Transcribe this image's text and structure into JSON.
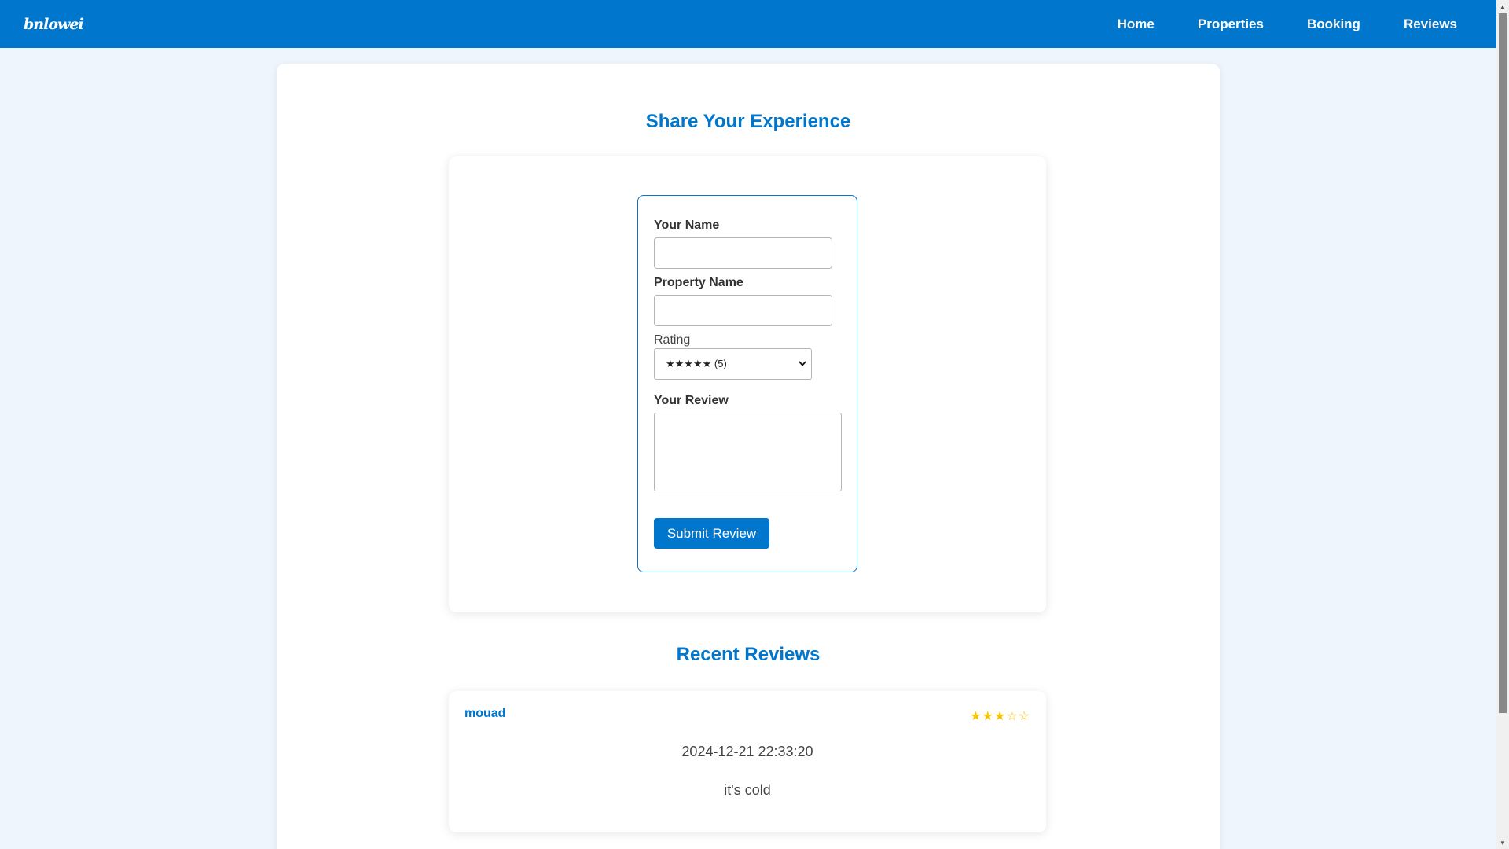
{
  "nav": {
    "logo": "bnlowei",
    "links": [
      "Home",
      "Properties",
      "Booking",
      "Reviews"
    ]
  },
  "form_section": {
    "title": "Share Your Experience",
    "name_label": "Your Name",
    "name_value": "",
    "property_label": "Property Name",
    "property_value": "",
    "rating_label": "Rating",
    "rating_selected": "★★★★★ (5)",
    "review_label": "Your Review",
    "review_value": "",
    "submit_label": "Submit Review"
  },
  "recent_section": {
    "title": "Recent Reviews",
    "reviews": [
      {
        "name": "mouad",
        "rating": 3,
        "stars": "★★★☆☆",
        "date": "2024-12-21 22:33:20",
        "text": "it's cold"
      }
    ]
  },
  "colors": {
    "primary": "#0077cc",
    "page_bg": "#eef5fd",
    "star": "#f5c400"
  }
}
